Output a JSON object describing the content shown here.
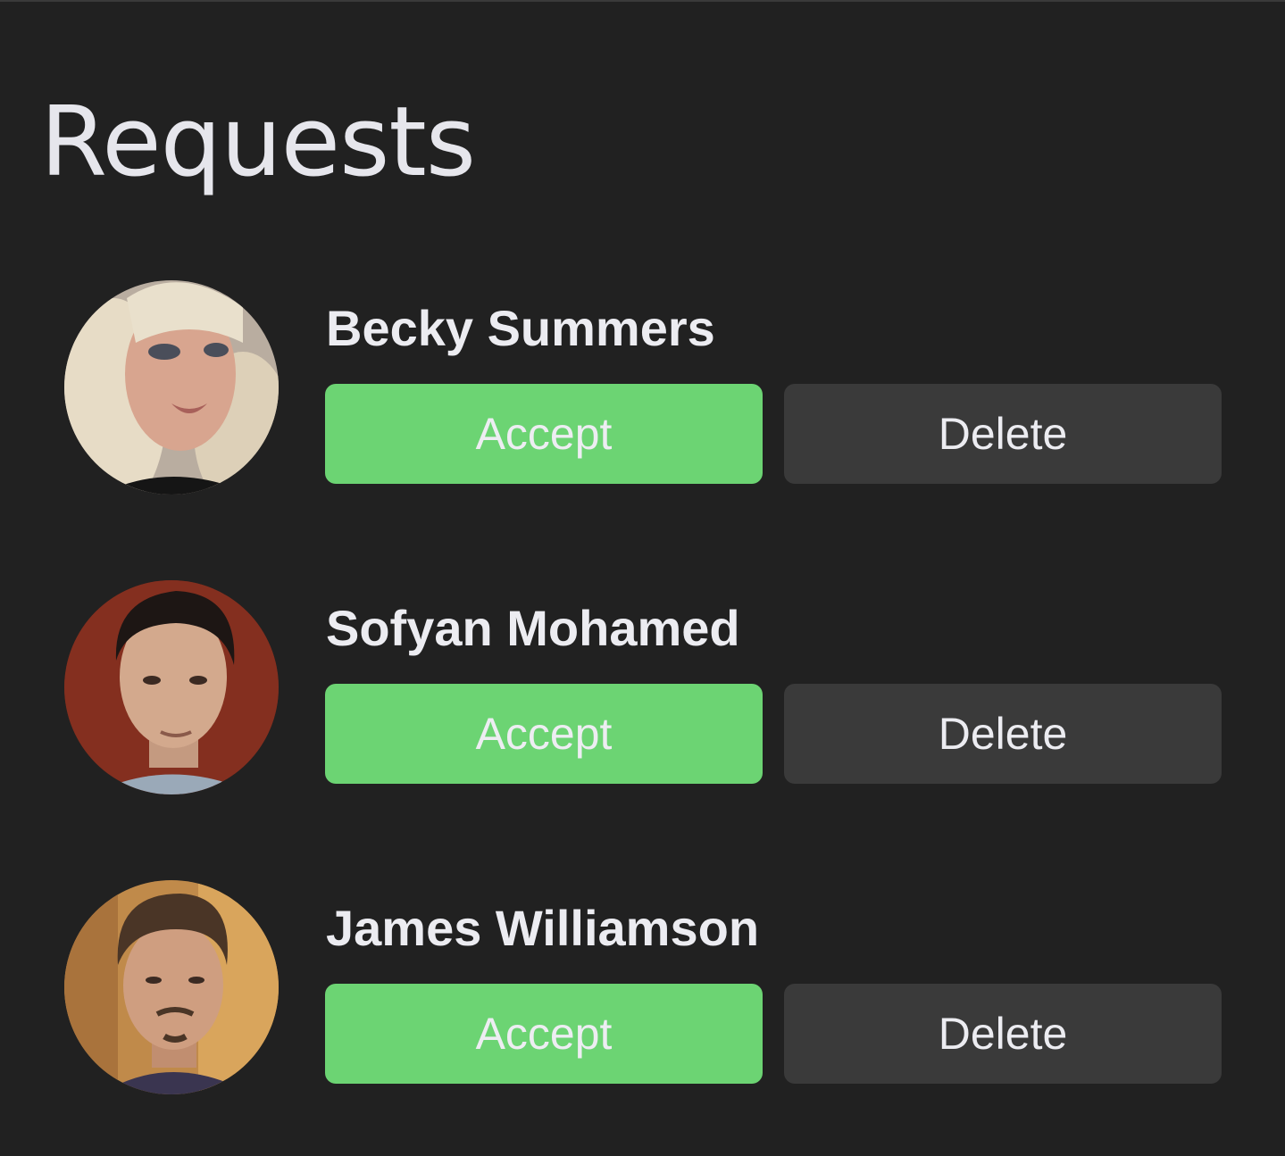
{
  "title": "Requests",
  "colors": {
    "background": "#212121",
    "accept": "#6cd473",
    "delete": "#3a3a3a",
    "text": "#ececf1"
  },
  "requests": [
    {
      "name": "Becky Summers",
      "accept_label": "Accept",
      "delete_label": "Delete",
      "avatar_icon": "avatar-photo"
    },
    {
      "name": "Sofyan Mohamed",
      "accept_label": "Accept",
      "delete_label": "Delete",
      "avatar_icon": "avatar-photo"
    },
    {
      "name": "James Williamson",
      "accept_label": "Accept",
      "delete_label": "Delete",
      "avatar_icon": "avatar-photo"
    }
  ]
}
